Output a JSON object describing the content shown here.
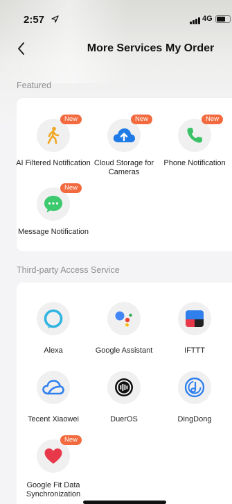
{
  "status_bar": {
    "time": "2:57",
    "network": "4G",
    "icons": [
      "location-arrow-icon",
      "signal-icon",
      "battery-icon"
    ]
  },
  "nav": {
    "back_icon": "chevron-left-icon",
    "title": "More Services",
    "right_label": "My Order"
  },
  "featured": {
    "section_title": "Featured",
    "items": [
      {
        "label": "AI Filtered Notification",
        "badge": "New",
        "icon": "walking-person-icon",
        "color": "#f2a623"
      },
      {
        "label": "Cloud Storage for Cameras",
        "badge": "New",
        "icon": "cloud-upload-icon",
        "color": "#1f7be6"
      },
      {
        "label": "Phone Notification",
        "badge": "New",
        "icon": "phone-icon",
        "color": "#3cc266"
      },
      {
        "label": "Message Notification",
        "badge": "New",
        "icon": "message-bubble-icon",
        "color": "#3dc96e"
      }
    ]
  },
  "third_party": {
    "section_title": "Third-party Access Service",
    "items": [
      {
        "label": "Alexa",
        "icon": "alexa-icon",
        "color": "#30b4e0"
      },
      {
        "label": "Google Assistant",
        "icon": "google-assistant-icon",
        "color": "#4285f4"
      },
      {
        "label": "IFTTT",
        "icon": "ifttt-icon",
        "color": "#2f80ed"
      },
      {
        "label": "Tecent Xiaowei",
        "icon": "cloud-outline-icon",
        "color": "#2f80ed"
      },
      {
        "label": "DuerOS",
        "icon": "dueros-icon",
        "color": "#111111"
      },
      {
        "label": "DingDong",
        "icon": "dingdong-icon",
        "color": "#2f80ed"
      },
      {
        "label": "Google Fit Data Synchronization",
        "badge": "New",
        "icon": "heart-icon",
        "color": "#e8394a"
      }
    ]
  },
  "colors": {
    "badge": "#f26a3d",
    "background": "#f4f4f6",
    "card": "#ffffff",
    "section_title": "#8e8e93"
  }
}
